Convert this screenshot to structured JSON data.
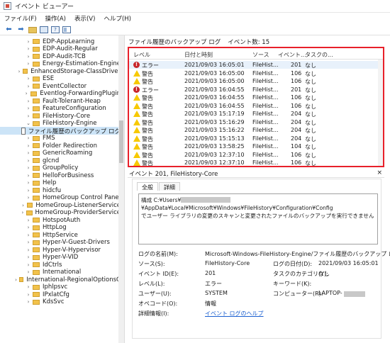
{
  "window": {
    "title": "イベント ビューアー"
  },
  "menu": [
    "ファイル(F)",
    "操作(A)",
    "表示(V)",
    "ヘルプ(H)"
  ],
  "toolbar": {
    "icons": [
      "back-arrow-icon",
      "forward-arrow-icon",
      "folder-icon",
      "panel-icon",
      "help-icon",
      "panel-toggle-icon"
    ]
  },
  "tree": {
    "items": [
      "EDP-AppLearning",
      "EDP-Audit-Regular",
      "EDP-Audit-TCB",
      "Energy-Estimation-Engine",
      "EnhancedStorage-ClassDriver",
      "ESE",
      "EventCollector",
      "Eventlog-ForwardingPlugin",
      "Fault-Tolerant-Heap",
      "FeatureConfiguration",
      "FileHistory-Core",
      "FileHistory-Engine",
      "ファイル履歴のバックアップ ログ",
      "FMS",
      "Folder Redirection",
      "GenericRoaming",
      "glcnd",
      "GroupPolicy",
      "HelloForBusiness",
      "Help",
      "hidcfu",
      "HomeGroup Control Panel",
      "HomeGroup-ListenerService",
      "HomeGroup-ProviderService",
      "HotspotAuth",
      "HttpLog",
      "HttpService",
      "Hyper-V-Guest-Drivers",
      "Hyper-V-Hypervisor",
      "Hyper-V-VID",
      "IdCtrls",
      "International",
      "International-RegionalOptionsC",
      "Iphlpsvc",
      "IPxlatCfg",
      "KdsSvc"
    ]
  },
  "right": {
    "title": "ファイル履歴のバックアップ ログ",
    "count": "イベント数: 15"
  },
  "list": {
    "headers": [
      "レベル",
      "日付と時刻",
      "ソース",
      "イベント...",
      "タスクの..."
    ],
    "rows": [
      {
        "level": "エラー",
        "type": "error",
        "date": "2021/09/03 16:05:01",
        "source": "FileHist...",
        "id": "201",
        "task": "なし"
      },
      {
        "level": "警告",
        "type": "warning",
        "date": "2021/09/03 16:05:00",
        "source": "FileHist...",
        "id": "106",
        "task": "なし"
      },
      {
        "level": "警告",
        "type": "warning",
        "date": "2021/09/03 16:05:00",
        "source": "FileHist...",
        "id": "106",
        "task": "なし"
      },
      {
        "level": "エラー",
        "type": "error",
        "date": "2021/09/03 16:04:55",
        "source": "FileHist...",
        "id": "201",
        "task": "なし"
      },
      {
        "level": "警告",
        "type": "warning",
        "date": "2021/09/03 16:04:55",
        "source": "FileHist...",
        "id": "106",
        "task": "なし"
      },
      {
        "level": "警告",
        "type": "warning",
        "date": "2021/09/03 16:04:55",
        "source": "FileHist...",
        "id": "106",
        "task": "なし"
      },
      {
        "level": "警告",
        "type": "warning",
        "date": "2021/09/03 15:17:19",
        "source": "FileHist...",
        "id": "204",
        "task": "なし"
      },
      {
        "level": "警告",
        "type": "warning",
        "date": "2021/09/03 15:16:29",
        "source": "FileHist...",
        "id": "204",
        "task": "なし"
      },
      {
        "level": "警告",
        "type": "warning",
        "date": "2021/09/03 15:16:22",
        "source": "FileHist...",
        "id": "204",
        "task": "なし"
      },
      {
        "level": "警告",
        "type": "warning",
        "date": "2021/09/03 15:15:13",
        "source": "FileHist...",
        "id": "204",
        "task": "なし"
      },
      {
        "level": "警告",
        "type": "warning",
        "date": "2021/09/03 13:58:25",
        "source": "FileHist...",
        "id": "104",
        "task": "なし"
      },
      {
        "level": "警告",
        "type": "warning",
        "date": "2021/09/03 12:37:10",
        "source": "FileHist...",
        "id": "106",
        "task": "なし"
      },
      {
        "level": "警告",
        "type": "warning",
        "date": "2021/09/03 12:37:10",
        "source": "FileHist...",
        "id": "106",
        "task": "なし"
      }
    ]
  },
  "detail": {
    "header": "イベント 201, FileHistory-Core",
    "close": "×",
    "tabs": [
      "全般",
      "詳細"
    ],
    "message": {
      "line1_prefix": "構成 C:¥Users¥",
      "line1_suffix": "¥AppData¥Local¥Microsoft¥Windows¥FileHistory¥Configuration¥Config",
      "line2": "でユーザー ライブラリの変更のスキャンと変更されたファイルのバックアップを実行できません"
    },
    "props": {
      "logname_label": "ログの名前(M):",
      "logname_value": "Microsoft-Windows-FileHistory-Engine/ファイル履歴のバックアップ ログ",
      "source_label": "ソース(S):",
      "source_value": "FileHistory-Core",
      "logdate_label": "ログの日付(D):",
      "logdate_value": "2021/09/03 16:05:01",
      "eventid_label": "イベント ID(E):",
      "eventid_value": "201",
      "taskcat_label": "タスクのカテゴリ(Y):",
      "taskcat_value": "なし",
      "level_label": "レベル(L):",
      "level_value": "エラー",
      "keyword_label": "キーワード(K):",
      "keyword_value": "",
      "user_label": "ユーザー(U):",
      "user_value": "SYSTEM",
      "computer_label": "コンピューター(R):",
      "computer_value": "LAPTOP-",
      "opcode_label": "オペコード(O):",
      "opcode_value": "情報",
      "moreinfo_label": "詳細情報(I):",
      "moreinfo_value": "イベント ログのヘルプ"
    }
  },
  "colors": {
    "highlight_border": "#e8202a",
    "selected": "#cce4f7",
    "link": "#1a5fd0",
    "error": "#c8262b",
    "warning": "#f7c900"
  }
}
